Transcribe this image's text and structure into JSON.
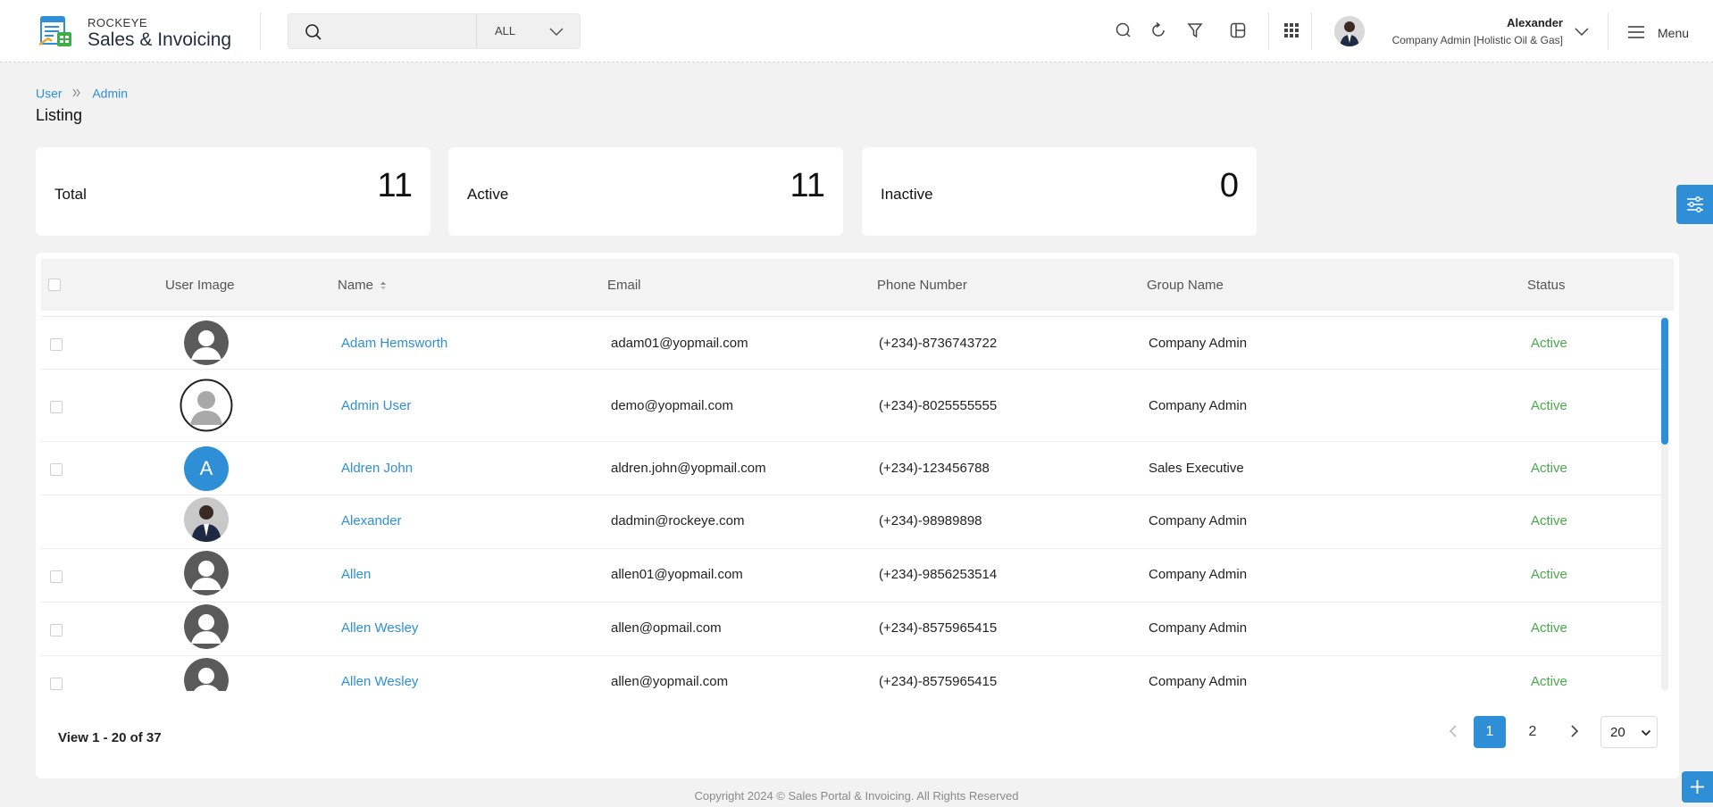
{
  "brand": {
    "small": "ROCKEYE",
    "big": "Sales & Invoicing"
  },
  "search": {
    "placeholder": "",
    "scope": "ALL"
  },
  "user": {
    "name": "Alexander",
    "role": "Company Admin [Holistic Oil & Gas]"
  },
  "menu": {
    "label": "Menu"
  },
  "breadcrumb": [
    "User",
    "Admin"
  ],
  "page_title": "Listing",
  "stats": [
    {
      "label": "Total",
      "value": "11"
    },
    {
      "label": "Active",
      "value": "11"
    },
    {
      "label": "Inactive",
      "value": "0"
    }
  ],
  "table": {
    "headers": {
      "image": "User Image",
      "name": "Name",
      "email": "Email",
      "phone": "Phone Number",
      "group": "Group Name",
      "status": "Status"
    },
    "rows": [
      {
        "name": "Adam Hemsworth",
        "email": "adam01@yopmail.com",
        "phone": "(+234)-8736743722",
        "group": "Company Admin",
        "status": "Active",
        "avatar": "placeholder"
      },
      {
        "name": "Admin User",
        "email": "demo@yopmail.com",
        "phone": "(+234)-8025555555",
        "group": "Company Admin",
        "status": "Active",
        "avatar": "placeholder-outlined"
      },
      {
        "name": "Aldren John",
        "email": "aldren.john@yopmail.com",
        "phone": "(+234)-123456788",
        "group": "Sales Executive",
        "status": "Active",
        "avatar": "initial",
        "initial": "A"
      },
      {
        "name": "Alexander",
        "email": "dadmin@rockeye.com",
        "phone": "(+234)-98989898",
        "group": "Company Admin",
        "status": "Active",
        "avatar": "photo"
      },
      {
        "name": "Allen",
        "email": "allen01@yopmail.com",
        "phone": "(+234)-9856253514",
        "group": "Company Admin",
        "status": "Active",
        "avatar": "placeholder"
      },
      {
        "name": "Allen Wesley",
        "email": "allen@opmail.com",
        "phone": "(+234)-8575965415",
        "group": "Company Admin",
        "status": "Active",
        "avatar": "placeholder"
      },
      {
        "name": "Allen Wesley",
        "email": "allen@yopmail.com",
        "phone": "(+234)-8575965415",
        "group": "Company Admin",
        "status": "Active",
        "avatar": "placeholder"
      }
    ]
  },
  "pagination": {
    "summary": "View 1 - 20 of 37",
    "current": "1",
    "next_page": "2",
    "page_size": "20"
  },
  "footer": {
    "copyright": "Copyright 2024 © Sales Portal & Invoicing. All Rights Reserved"
  },
  "colors": {
    "accent": "#2e8fd6",
    "status_active": "#4aa84a"
  }
}
